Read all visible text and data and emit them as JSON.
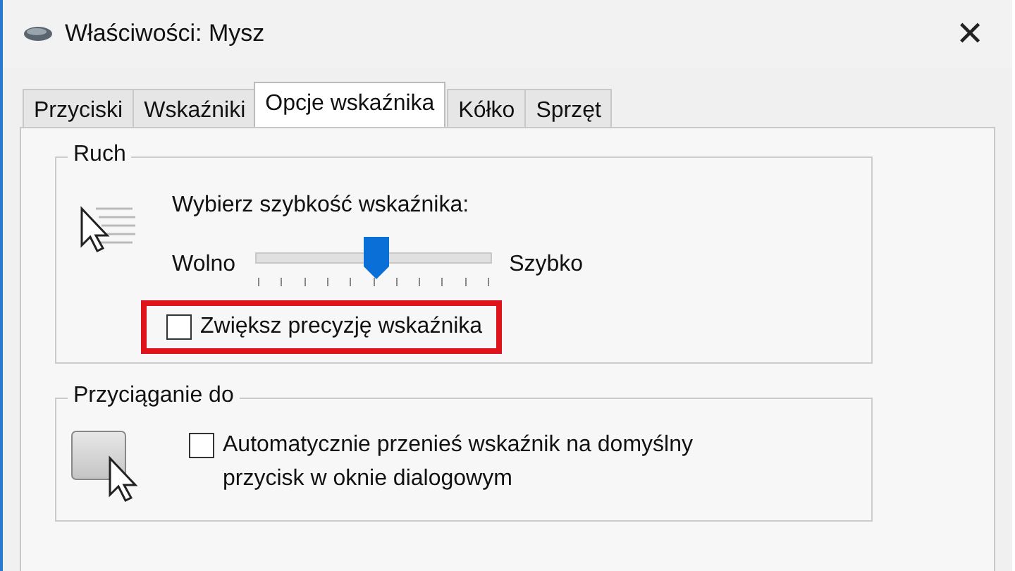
{
  "window": {
    "title": "Właściwości: Mysz",
    "close": "✕"
  },
  "tabs": [
    {
      "label": "Przyciski",
      "selected": false
    },
    {
      "label": "Wskaźniki",
      "selected": false
    },
    {
      "label": "Opcje wskaźnika",
      "selected": true
    },
    {
      "label": "Kółko",
      "selected": false
    },
    {
      "label": "Sprzęt",
      "selected": false
    }
  ],
  "motion": {
    "title": "Ruch",
    "prompt": "Wybierz szybkość wskaźnika:",
    "slow": "Wolno",
    "fast": "Szybko",
    "level": 0.51,
    "precision": {
      "label": "Zwiększ precyzję wskaźnika",
      "checked": false,
      "highlighted": true
    }
  },
  "snap": {
    "title": "Przyciąganie do",
    "option": {
      "label": "Automatycznie przenieś wskaźnik na domyślny przycisk w oknie dialogowym",
      "checked": false
    }
  }
}
